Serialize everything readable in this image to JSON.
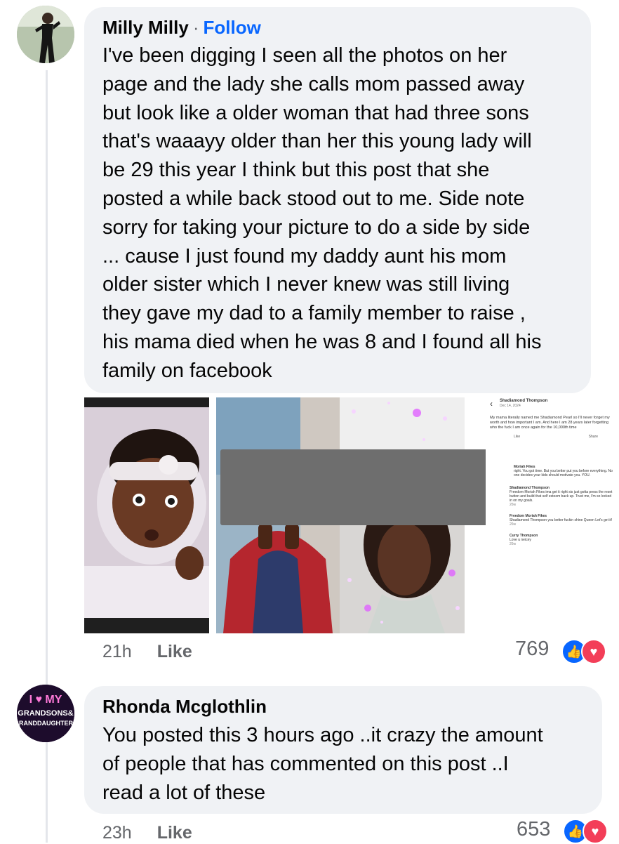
{
  "comments": [
    {
      "author": "Milly Milly",
      "separator": "·",
      "follow_label": "Follow",
      "text": "I've been digging I seen all the photos on her\npage and the lady she calls mom passed away\nbut look like a older woman that had three sons\nthat's waaayy older than her this young lady will\nbe 29 this year I think but this post that she\nposted a while back stood out to me. Side note\nsorry for taking your picture to do a side by side\n... cause I just found my daddy aunt his mom\nolder sister which I never knew was still living\nthey gave my dad to a family member to raise ,\nhis mama died when he was 8 and I found all his\nfamily on facebook",
      "time": "21h",
      "like_label": "Like",
      "reaction_count": "769"
    },
    {
      "author": "Rhonda Mcglothlin",
      "text": "You posted this 3 hours ago ..it crazy the amount\nof people that has commented on this post ..I\nread a lot of these",
      "time": "23h",
      "like_label": "Like",
      "reaction_count": "653"
    }
  ],
  "avatar2_text": "I ♥ MY GRANDSONS & GRANDDAUGHTERS",
  "screenshot_photo": {
    "header_name": "Shadiamond Thompson",
    "header_date": "Dec 14, 2024",
    "post_text": "My mama literally named me Shadiamond Pearl so I'll never forget my worth and how important I am. And here I am 28 years later forgetting who the fuck I am once again for the 10,000th time",
    "like_label": "Like",
    "share_label": "Share",
    "replies": [
      {
        "name": "Moriah Fikes",
        "text": "right. You got time. But you better put you before everything. No one decides your kids should motivate you. YOU."
      },
      {
        "name": "Shadiamond Thompson",
        "text": "Freedom Moriah Fikes ima get it right sis just gotta press the reset button and build that self esteem back up. Trust me, I'm so locked in on my goals.",
        "time": "26w"
      },
      {
        "name": "Freedom Moriah Fikes",
        "text": "Shadiamond Thompson you better fuckin shine Queen Let's get it!",
        "time": "26w"
      },
      {
        "name": "Curry Thompson",
        "text": "Love u neicey",
        "time": "26w"
      }
    ]
  },
  "colors": {
    "follow": "#0866ff",
    "bubble": "#f0f2f5",
    "like_reaction": "#0866ff",
    "love_reaction": "#f33e58",
    "muted": "#65676b"
  }
}
